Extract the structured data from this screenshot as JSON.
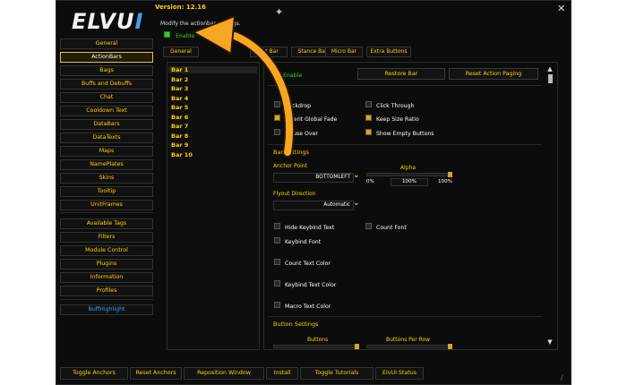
{
  "app": {
    "logo_text": "ELVU",
    "logo_accent": "I",
    "version": "Version: 12.16",
    "subtitle": "Modify the actionbar settings.",
    "top_enable_label": "Enable"
  },
  "sidebar": {
    "items": [
      {
        "label": "General"
      },
      {
        "label": "ActionBars",
        "selected": true
      },
      {
        "label": "Bags"
      },
      {
        "label": "Buffs and Debuffs"
      },
      {
        "label": "Chat"
      },
      {
        "label": "Cooldown Text"
      },
      {
        "label": "DataBars"
      },
      {
        "label": "DataTexts"
      },
      {
        "label": "Maps"
      },
      {
        "label": "NamePlates"
      },
      {
        "label": "Skins"
      },
      {
        "label": "Tooltip"
      },
      {
        "label": "UnitFrames"
      },
      {
        "label": "Available Tags"
      },
      {
        "label": "Filters"
      },
      {
        "label": "Module Control"
      },
      {
        "label": "Plugins"
      },
      {
        "label": "Information"
      },
      {
        "label": "Profiles"
      },
      {
        "label": "BuffHighlight",
        "accent": "#3da0e8"
      }
    ]
  },
  "tabs": [
    "General",
    "Pet Bar",
    "Stance Bar",
    "Micro Bar",
    "Extra Buttons"
  ],
  "bars": [
    "Bar 1",
    "Bar 2",
    "Bar 3",
    "Bar 4",
    "Bar 5",
    "Bar 6",
    "Bar 7",
    "Bar 8",
    "Bar 9",
    "Bar 10"
  ],
  "panel": {
    "enable_label": "Enable",
    "restore_bar": "Restore Bar",
    "reset_paging": "Reset Action Paging",
    "checks": {
      "backdrop": "Backdrop",
      "click_through": "Click Through",
      "inherit_fade": "Inherit Global Fade",
      "keep_size_ratio": "Keep Size Ratio",
      "mouse_over": "Mouse Over",
      "show_empty": "Show Empty Buttons"
    },
    "bar_settings": "Bar Settings",
    "anchor_point_label": "Anchor Point",
    "anchor_point_value": "BOTTOMLEFT",
    "alpha_label": "Alpha",
    "alpha_min": "0%",
    "alpha_value": "100%",
    "alpha_max": "100%",
    "alpha_level": 1.0,
    "flyout_label": "Flyout Direction",
    "flyout_value": "Automatic",
    "hide_keybind": "Hide Keybind Text",
    "count_font": "Count Font",
    "keybind_font": "Keybind Font",
    "count_text_color": "Count Text Color",
    "keybind_text_color": "Keybind Text Color",
    "macro_text_color": "Macro Text Color",
    "button_settings": "Button Settings",
    "buttons_label": "Buttons",
    "buttons_per_row_label": "Buttons Per Row"
  },
  "bottom": [
    "Toggle Anchors",
    "Reset Anchors",
    "Reposition Window",
    "Install",
    "Toggle Tutorials",
    "ElvUI Status"
  ],
  "colors": {
    "accent": "#ffd100",
    "highlight": "#3da0e8",
    "arrow": "#f5a623"
  }
}
